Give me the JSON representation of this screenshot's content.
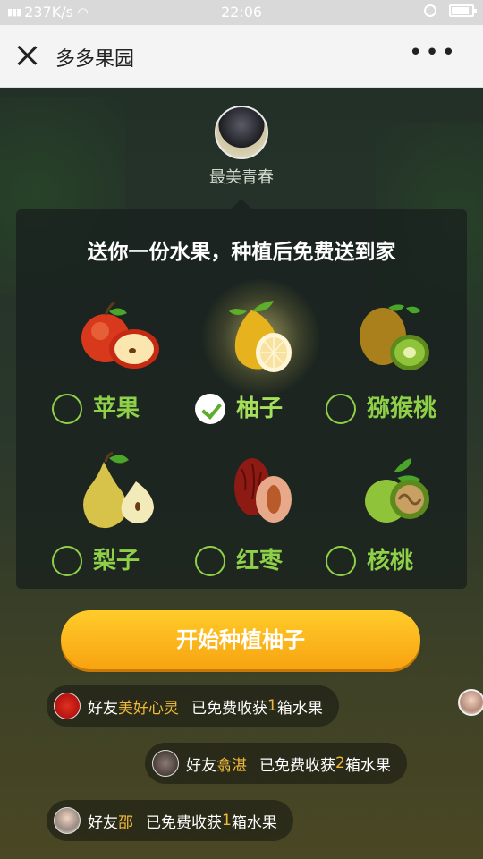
{
  "status_bar": {
    "network_speed": "237K/s",
    "time": "22:06",
    "battery_level": 0.85
  },
  "nav": {
    "title": "多多果园"
  },
  "profile": {
    "name": "最美青春"
  },
  "panel": {
    "title": "送你一份水果，种植后免费送到家",
    "fruits": [
      {
        "label": "苹果",
        "icon": "apple-icon",
        "selected": false
      },
      {
        "label": "柚子",
        "icon": "pomelo-icon",
        "selected": true
      },
      {
        "label": "猕猴桃",
        "icon": "kiwi-icon",
        "selected": false
      },
      {
        "label": "梨子",
        "icon": "pear-icon",
        "selected": false
      },
      {
        "label": "红枣",
        "icon": "jujube-icon",
        "selected": false
      },
      {
        "label": "核桃",
        "icon": "walnut-icon",
        "selected": false
      }
    ]
  },
  "start_button": {
    "label": "开始种植柚子"
  },
  "feed": [
    {
      "prefix": "好友",
      "name": "美好心灵",
      "action": "已免费收获",
      "count": "1",
      "unit": "箱水果"
    },
    {
      "prefix": "好友",
      "name": "翕湛",
      "action": "已免费收获",
      "count": "2",
      "unit": "箱水果"
    },
    {
      "prefix": "好友",
      "name": "邵",
      "action": "已免费收获",
      "count": "1",
      "unit": "箱水果"
    }
  ],
  "colors": {
    "accent_green": "#8fd049",
    "button_orange": "#f8a311",
    "highlight_gold": "#f0b93a"
  }
}
